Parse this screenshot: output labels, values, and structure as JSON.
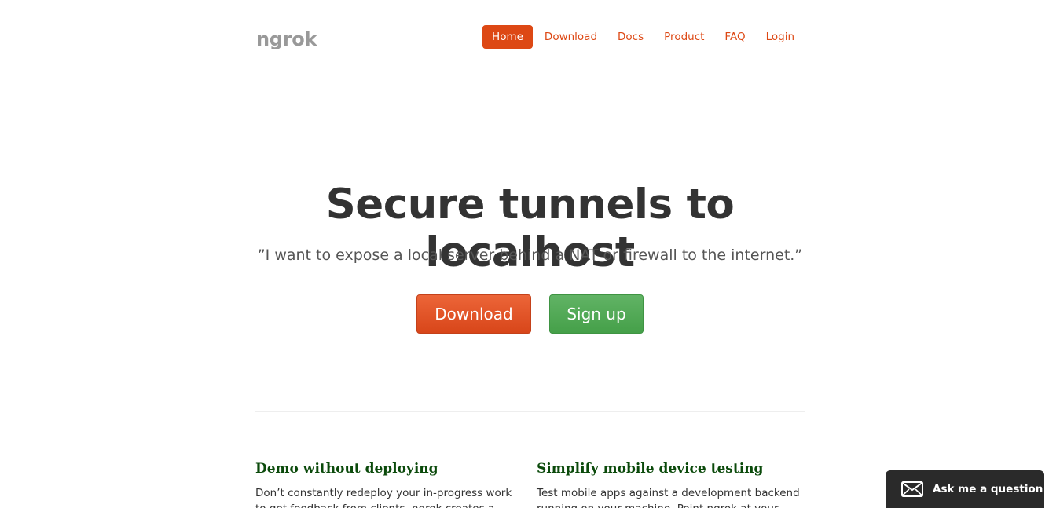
{
  "header": {
    "brand": "ngrok",
    "nav": [
      {
        "label": "Home",
        "active": true
      },
      {
        "label": "Download",
        "active": false
      },
      {
        "label": "Docs",
        "active": false
      },
      {
        "label": "Product",
        "active": false
      },
      {
        "label": "FAQ",
        "active": false
      },
      {
        "label": "Login",
        "active": false
      }
    ]
  },
  "hero": {
    "title": "Secure tunnels to localhost",
    "quote": "”I want to expose a local server behind a NAT or firewall to the internet.”",
    "download_label": "Download",
    "signup_label": "Sign up"
  },
  "features": [
    {
      "title": "Demo without deploying",
      "text": "Don’t constantly redeploy your in-progress work to get feedback from clients. ngrok creates a secure"
    },
    {
      "title": "Simplify mobile device testing",
      "text": "Test mobile apps against a development backend running on your machine. Point ngrok at your local dev"
    }
  ],
  "ask_widget": {
    "label": "Ask me a question",
    "icon": "mail-icon"
  },
  "colors": {
    "accent": "#dd4814",
    "signup": "#4cae4c",
    "feature_title": "#0b4a0b"
  }
}
